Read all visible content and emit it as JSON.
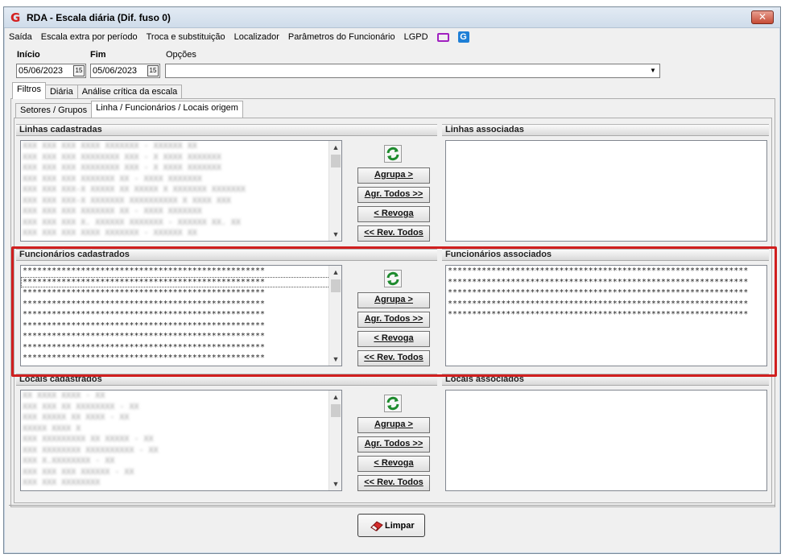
{
  "window": {
    "title": "RDA - Escala diária (Dif. fuso 0)",
    "close_label": "✕"
  },
  "menu": {
    "items": [
      "Saída",
      "Escala extra por período",
      "Troca e substituição",
      "Localizador",
      "Parâmetros do Funcionário",
      "LGPD"
    ],
    "icons": [
      "monitor-icon",
      "g-logo-icon"
    ]
  },
  "filters": {
    "inicio_label": "Início",
    "fim_label": "Fim",
    "opcoes_label": "Opções",
    "inicio_value": "05/06/2023",
    "fim_value": "05/06/2023",
    "calendar_glyph": "15",
    "opcoes_value": ""
  },
  "tabs": [
    "Filtros",
    "Diária",
    "Análise crítica da escala"
  ],
  "subtabs": [
    "Setores / Grupos",
    "Linha / Funcionários / Locais origem"
  ],
  "sections": {
    "linhas_cadastradas": "Linhas cadastradas",
    "linhas_associadas": "Linhas associadas",
    "funcionarios_cadastrados": "Funcionários cadastrados",
    "funcionarios_associados": "Funcionários associados",
    "locais_cadastrados": "Locais cadastrados",
    "locais_associados": "Locais associados"
  },
  "buttons": {
    "agrupa": "Agrupa >",
    "agr_todos": "Agr. Todos >>",
    "revoga": "< Revoga",
    "rev_todos": "<< Rev. Todos",
    "limpar": "Limpar"
  },
  "lists": {
    "linhas": [
      "XXX XXX XXX       XXXX XXXXXXX - XXXXXX XX",
      "XXX XXX XXX       XXXXXXXX XXX - X XXXX XXXXXXX",
      "XXX XXX XXX       XXXXXXXX XXX - X XXXX XXXXXXX",
      "XXX XXX XXX       XXXXXXX XX - XXXX XXXXXXX",
      "XXX XXX XXX-X     XXXXX XX XXXXX X XXXXXXX XXXXXXX",
      "XXX XXX XXX-X     XXXXXXX XXXXXXXXXX X XXXX XXX",
      "XXX XXX XXX       XXXXXXX XX - XXXX XXXXXXX",
      "XXX XXX XXX       X. XXXXXX XXXXXXX - XXXXXX XX. XX",
      "XXX XXX XXX       XXXX XXXXXXX - XXXXXX XX"
    ],
    "funcionarios": [
      "**************************************************",
      "**************************************************",
      "**************************************************",
      "**************************************************",
      "**************************************************",
      "**************************************************",
      "**************************************************",
      "**************************************************",
      "**************************************************"
    ],
    "funcionarios_associados": [
      "**************************************************************",
      "**************************************************************",
      "**************************************************************",
      "**************************************************************",
      "**************************************************************"
    ],
    "locais": [
      "XX            XXXX XXXX - XX",
      "XXX           XXX XX XXXXXXXX - XX",
      "XXX           XXXXX XX XXXX - XX",
      "XXXXX         XXXX X",
      "XXX           XXXXXXXXX XX XXXXX - XX",
      "XXX           XXXXXXXX XXXXXXXXXX - XX",
      "XXX           X.XXXXXXXX - XX",
      "XXX           XXX XXX XXXXXX - XX",
      "XXX           XXX XXXXXXXX"
    ]
  }
}
